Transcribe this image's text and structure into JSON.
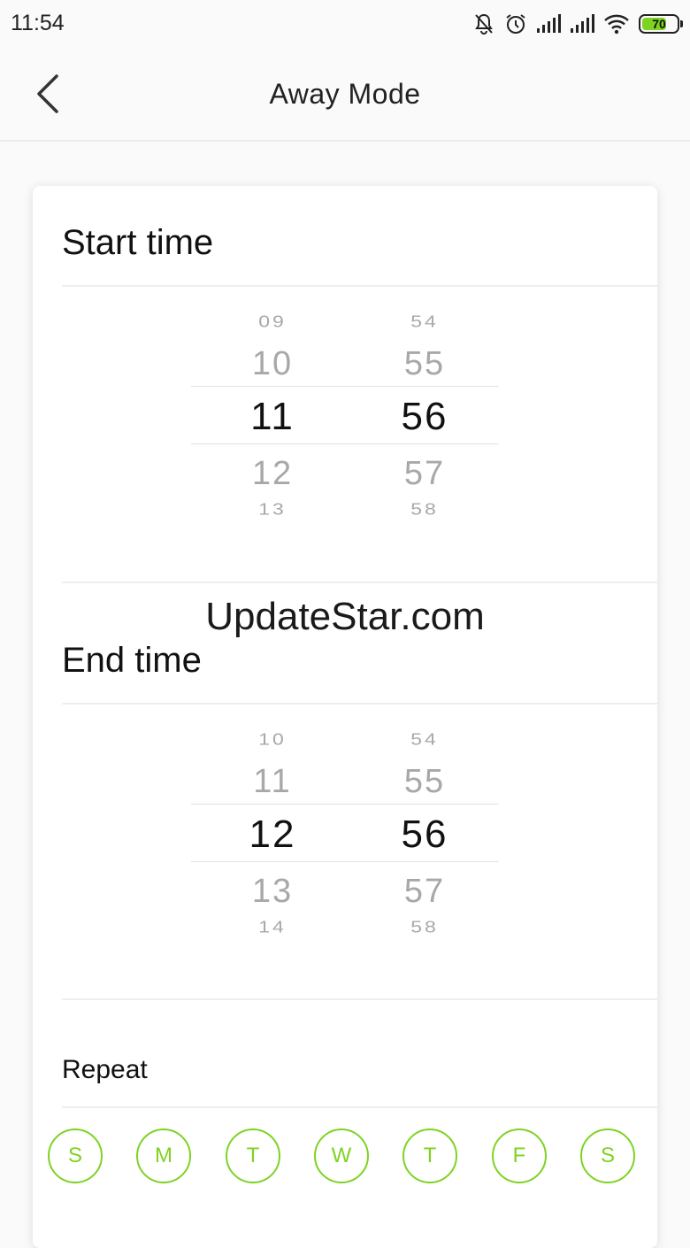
{
  "status_bar": {
    "time": "11:54",
    "battery_level": "70",
    "battery_percent": 70,
    "icons": [
      "notifications-off-icon",
      "alarm-icon",
      "signal-icon",
      "signal-icon",
      "wifi-icon",
      "battery-icon"
    ]
  },
  "header": {
    "title": "Away Mode",
    "back_icon": "chevron-left-icon"
  },
  "start_time": {
    "label": "Start time",
    "hours": [
      "09",
      "10",
      "11",
      "12",
      "13"
    ],
    "minutes": [
      "54",
      "55",
      "56",
      "57",
      "58"
    ]
  },
  "watermark": "UpdateStar.com",
  "end_time": {
    "label": "End time",
    "hours": [
      "10",
      "11",
      "12",
      "13",
      "14"
    ],
    "minutes": [
      "54",
      "55",
      "56",
      "57",
      "58"
    ]
  },
  "repeat": {
    "label": "Repeat",
    "days": [
      "S",
      "M",
      "T",
      "W",
      "T",
      "F",
      "S"
    ]
  },
  "colors": {
    "accent": "#7ed321",
    "background": "#fafafa",
    "card": "#ffffff"
  }
}
